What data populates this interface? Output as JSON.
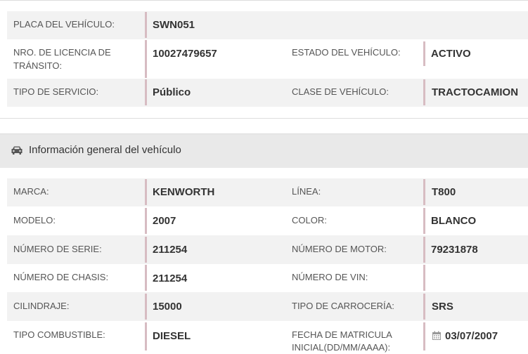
{
  "vehicle": {
    "placa": {
      "label": "PLACA DEL VEHÍCULO:",
      "value": "SWN051"
    },
    "licencia": {
      "label_line1": "NRO. DE LICENCIA DE",
      "label_line2": "TRÁNSITO:",
      "value": "10027479657"
    },
    "estado": {
      "label": "ESTADO DEL VEHÍCULO:",
      "value": "ACTIVO"
    },
    "servicio": {
      "label": "TIPO DE SERVICIO:",
      "value": "Público"
    },
    "clase": {
      "label": "CLASE DE VEHÍCULO:",
      "value": "TRACTOCAMION"
    }
  },
  "general_section": {
    "icon": "car-icon",
    "title": "Información general del vehículo"
  },
  "general": {
    "marca": {
      "label": "MARCA:",
      "value": "KENWORTH"
    },
    "linea": {
      "label": "LÍNEA:",
      "value": "T800"
    },
    "modelo": {
      "label": "MODELO:",
      "value": "2007"
    },
    "color": {
      "label": "COLOR:",
      "value": "BLANCO"
    },
    "serie": {
      "label": "NÚMERO DE SERIE:",
      "value": "211254"
    },
    "motor": {
      "label": "NÚMERO DE MOTOR:",
      "value": "79231878"
    },
    "chasis": {
      "label": "NÚMERO DE CHASIS:",
      "value": "211254"
    },
    "vin": {
      "label": "NÚMERO DE VIN:",
      "value": ""
    },
    "cilindraje": {
      "label": "CILINDRAJE:",
      "value": "15000"
    },
    "carroceria": {
      "label": "TIPO DE CARROCERÍA:",
      "value": "SRS"
    },
    "combustible": {
      "label": "TIPO COMBUSTIBLE:",
      "value": "DIESEL"
    },
    "matricula": {
      "label_line1": "FECHA DE MATRICULA",
      "label_line2": "INICIAL(DD/MM/AAAA):",
      "value": "03/07/2007",
      "icon": "calendar-icon"
    }
  },
  "colors": {
    "row_shade": "#f2f2f2",
    "accent_bar": "#d7bcc2",
    "section_bg": "#e9e9e9"
  }
}
